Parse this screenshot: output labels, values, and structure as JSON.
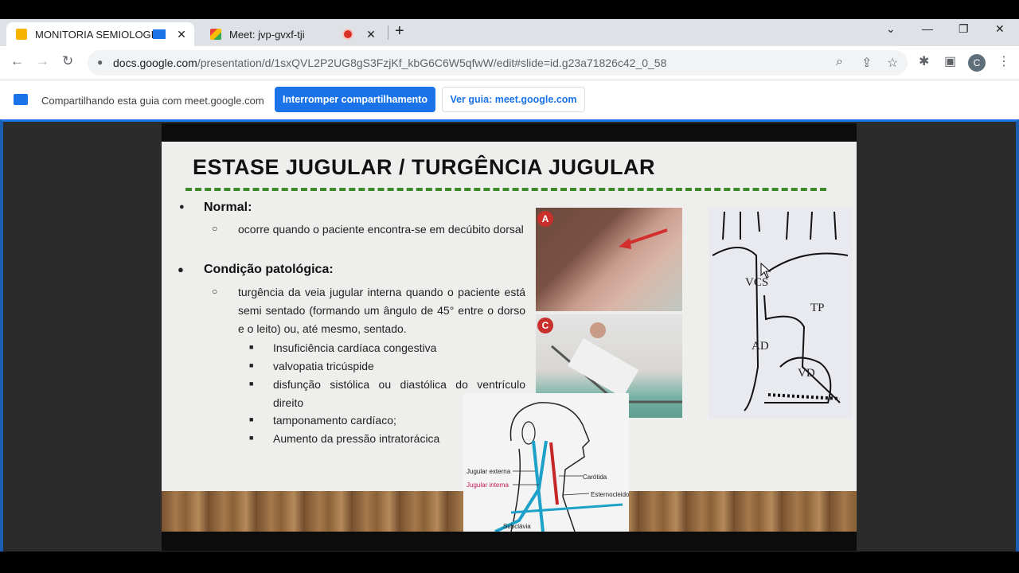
{
  "browser": {
    "tabs": [
      {
        "title": "MONITORIA SEMIOLOGIA C",
        "favicon_color": "#f4b400"
      },
      {
        "title": "Meet: jvp-gvxf-tji",
        "favicon_color": "#00897b"
      }
    ],
    "close_glyph": "✕",
    "newtab_glyph": "+",
    "window_controls": {
      "dropdown": "⌄",
      "minimize": "—",
      "restore": "❐",
      "close": "✕"
    },
    "nav": {
      "back": "←",
      "forward": "→",
      "reload": "↻"
    },
    "url_host": "docs.google.com",
    "url_path": "/presentation/d/1sxQVL2P2UG8gS3FzjKf_kbG6C6W5qfwW/edit#slide=id.g23a71826c42_0_58",
    "toolbar_icons": {
      "zoom": "⌕",
      "share": "⇪",
      "bookmark": "☆",
      "extensions": "✱",
      "sidebar": "▣",
      "menu": "⋮"
    },
    "profile_initial": "C"
  },
  "share_bar": {
    "text": "Compartilhando esta guia com meet.google.com",
    "stop_button": "Interromper compartilhamento",
    "view_button": "Ver guia: meet.google.com"
  },
  "slide": {
    "title": "ESTASE JUGULAR  / TURGÊNCIA JUGULAR",
    "normal_heading": "Normal:",
    "normal_text": "ocorre quando o paciente encontra-se em decúbito dorsal",
    "patologica_heading": "Condição patológica:",
    "patologica_text": "turgência da veia jugular interna quando o paciente está semi sentado (formando um ângulo de 45° entre o dorso e o leito) ou, até mesmo, sentado.",
    "causes": [
      "Insuficiência cardíaca congestiva",
      "valvopatia tricúspide",
      "disfunção sistólica ou diastólica do ventrículo direito",
      "tamponamento cardíaco;",
      "Aumento da pressão intratorácica"
    ],
    "bullets": {
      "level1": "●",
      "level2": "○",
      "level3": "■"
    },
    "figure_letters": [
      "A",
      "C"
    ],
    "heart_labels": [
      "VCS",
      "TP",
      "AD",
      "VD"
    ],
    "neck_labels": {
      "jugular_externa": "Jugular externa",
      "jugular_interna": "Jugular interna",
      "carotida": "Carótida",
      "esternocleido": "Esternocleido",
      "subclavia": "Subclávia"
    }
  }
}
